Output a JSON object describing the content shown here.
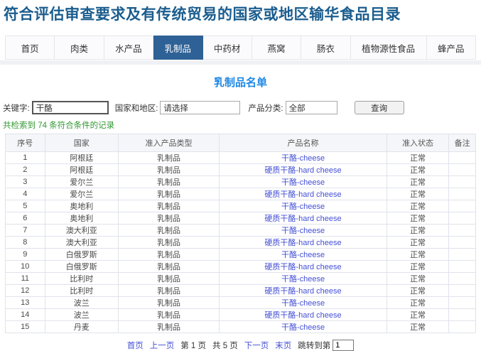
{
  "header": {
    "title": "符合评估审查要求及有传统贸易的国家或地区输华食品目录"
  },
  "nav": {
    "tabs": [
      {
        "key": "home",
        "label": "首页",
        "active": false
      },
      {
        "key": "meat",
        "label": "肉类",
        "active": false
      },
      {
        "key": "aquatic",
        "label": "水产品",
        "active": false
      },
      {
        "key": "dairy",
        "label": "乳制品",
        "active": true
      },
      {
        "key": "herbs",
        "label": "中药材",
        "active": false
      },
      {
        "key": "birds-nest",
        "label": "燕窝",
        "active": false
      },
      {
        "key": "casings",
        "label": "肠衣",
        "active": false
      },
      {
        "key": "plant-foods",
        "label": "植物源性食品",
        "active": false
      },
      {
        "key": "bee-products",
        "label": "蜂产品",
        "active": false
      }
    ]
  },
  "page": {
    "title": "乳制品名单"
  },
  "search": {
    "keyword_label": "关键字:",
    "keyword_value": "干酪",
    "country_label": "国家和地区:",
    "country_value": "请选择",
    "category_label": "产品分类:",
    "category_value": "全部",
    "query_button": "查询",
    "result_summary": "共检索到 74 条符合条件的记录"
  },
  "table": {
    "headers": [
      "序号",
      "国家",
      "准入产品类型",
      "产品名称",
      "准入状态",
      "备注"
    ],
    "rows": [
      {
        "seq": "1",
        "country": "阿根廷",
        "type": "乳制品",
        "product": "干酪-cheese",
        "status": "正常",
        "remark": ""
      },
      {
        "seq": "2",
        "country": "阿根廷",
        "type": "乳制品",
        "product": "硬质干酪-hard cheese",
        "status": "正常",
        "remark": ""
      },
      {
        "seq": "3",
        "country": "爱尔兰",
        "type": "乳制品",
        "product": "干酪-cheese",
        "status": "正常",
        "remark": ""
      },
      {
        "seq": "4",
        "country": "爱尔兰",
        "type": "乳制品",
        "product": "硬质干酪-hard cheese",
        "status": "正常",
        "remark": ""
      },
      {
        "seq": "5",
        "country": "奥地利",
        "type": "乳制品",
        "product": "干酪-cheese",
        "status": "正常",
        "remark": ""
      },
      {
        "seq": "6",
        "country": "奥地利",
        "type": "乳制品",
        "product": "硬质干酪-hard cheese",
        "status": "正常",
        "remark": ""
      },
      {
        "seq": "7",
        "country": "澳大利亚",
        "type": "乳制品",
        "product": "干酪-cheese",
        "status": "正常",
        "remark": ""
      },
      {
        "seq": "8",
        "country": "澳大利亚",
        "type": "乳制品",
        "product": "硬质干酪-hard cheese",
        "status": "正常",
        "remark": ""
      },
      {
        "seq": "9",
        "country": "白俄罗斯",
        "type": "乳制品",
        "product": "干酪-cheese",
        "status": "正常",
        "remark": ""
      },
      {
        "seq": "10",
        "country": "白俄罗斯",
        "type": "乳制品",
        "product": "硬质干酪-hard cheese",
        "status": "正常",
        "remark": ""
      },
      {
        "seq": "11",
        "country": "比利时",
        "type": "乳制品",
        "product": "干酪-cheese",
        "status": "正常",
        "remark": ""
      },
      {
        "seq": "12",
        "country": "比利时",
        "type": "乳制品",
        "product": "硬质干酪-hard cheese",
        "status": "正常",
        "remark": ""
      },
      {
        "seq": "13",
        "country": "波兰",
        "type": "乳制品",
        "product": "干酪-cheese",
        "status": "正常",
        "remark": ""
      },
      {
        "seq": "14",
        "country": "波兰",
        "type": "乳制品",
        "product": "硬质干酪-hard cheese",
        "status": "正常",
        "remark": ""
      },
      {
        "seq": "15",
        "country": "丹麦",
        "type": "乳制品",
        "product": "干酪-cheese",
        "status": "正常",
        "remark": ""
      }
    ]
  },
  "pagination": {
    "first": "首页",
    "prev": "上一页",
    "current_page": "第 1 页",
    "total_pages": "共 5 页",
    "next": "下一页",
    "last": "末页",
    "jump_label": "跳转到第",
    "jump_value": "1"
  },
  "colors": {
    "header_title": "#1b5d8e",
    "active_tab": "#2e6195",
    "page_title": "#1e88e5",
    "link_blue": "#4450d4",
    "success_green": "#339933"
  }
}
